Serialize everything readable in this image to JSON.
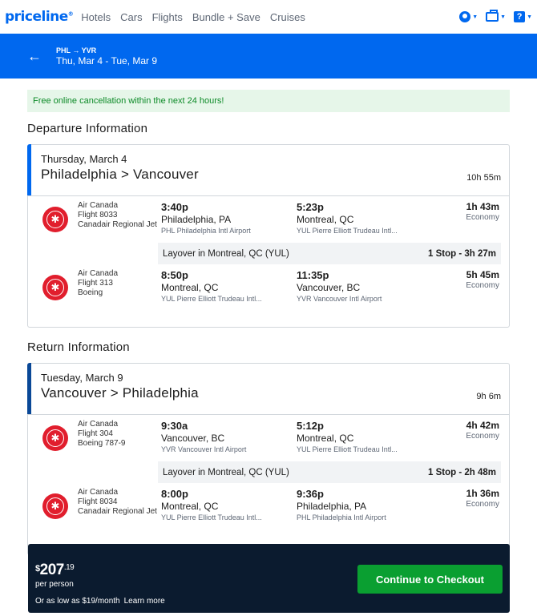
{
  "nav": {
    "logo": "priceline",
    "links": [
      "Hotels",
      "Cars",
      "Flights",
      "Bundle + Save",
      "Cruises"
    ]
  },
  "header": {
    "route": "PHL → YVR",
    "dates": "Thu, Mar 4 - Tue, Mar 9"
  },
  "notice": "Free online cancellation within the next 24 hours!",
  "departure": {
    "title": "Departure Information",
    "day": "Thursday, March 4",
    "cities": "Philadelphia > Vancouver",
    "duration": "10h 55m",
    "seg1": {
      "airline": "Air Canada",
      "flight": "Flight 8033",
      "aircraft": "Canadair Regional Jet",
      "dep_time": "3:40p",
      "dep_city": "Philadelphia, PA",
      "dep_airport": "PHL Philadelphia Intl Airport",
      "arr_time": "5:23p",
      "arr_city": "Montreal, QC",
      "arr_airport": "YUL Pierre Elliott Trudeau Intl...",
      "duration": "1h 43m",
      "cabin": "Economy"
    },
    "layover": {
      "text": "Layover in Montreal, QC (YUL)",
      "stops": "1 Stop - 3h 27m"
    },
    "seg2": {
      "airline": "Air Canada",
      "flight": "Flight 313",
      "aircraft": "Boeing",
      "dep_time": "8:50p",
      "dep_city": "Montreal, QC",
      "dep_airport": "YUL Pierre Elliott Trudeau Intl...",
      "arr_time": "11:35p",
      "arr_city": "Vancouver, BC",
      "arr_airport": "YVR Vancouver Intl Airport",
      "duration": "5h 45m",
      "cabin": "Economy"
    }
  },
  "return": {
    "title": "Return Information",
    "day": "Tuesday, March 9",
    "cities": "Vancouver > Philadelphia",
    "duration": "9h 6m",
    "seg1": {
      "airline": "Air Canada",
      "flight": "Flight 304",
      "aircraft": "Boeing 787-9",
      "dep_time": "9:30a",
      "dep_city": "Vancouver, BC",
      "dep_airport": "YVR Vancouver Intl Airport",
      "arr_time": "5:12p",
      "arr_city": "Montreal, QC",
      "arr_airport": "YUL Pierre Elliott Trudeau Intl...",
      "duration": "4h 42m",
      "cabin": "Economy"
    },
    "layover": {
      "text": "Layover in Montreal, QC (YUL)",
      "stops": "1 Stop - 2h 48m"
    },
    "seg2": {
      "airline": "Air Canada",
      "flight": "Flight 8034",
      "aircraft": "Canadair Regional Jet",
      "dep_time": "8:00p",
      "dep_city": "Montreal, QC",
      "dep_airport": "YUL Pierre Elliott Trudeau Intl...",
      "arr_time": "9:36p",
      "arr_city": "Philadelphia, PA",
      "arr_airport": "PHL Philadelphia Intl Airport",
      "duration": "1h 36m",
      "cabin": "Economy"
    }
  },
  "checkout": {
    "currency": "$",
    "price_whole": "207",
    "price_cents": ".19",
    "per_person": "per person",
    "as_low": "Or as low as $19/month",
    "learn_more": "Learn more",
    "button": "Continue to Checkout"
  },
  "colors": {
    "brand": "#0068ef",
    "cta": "#0a9f31",
    "bar": "#0b1b2f",
    "notice_bg": "#e6f6e9"
  }
}
